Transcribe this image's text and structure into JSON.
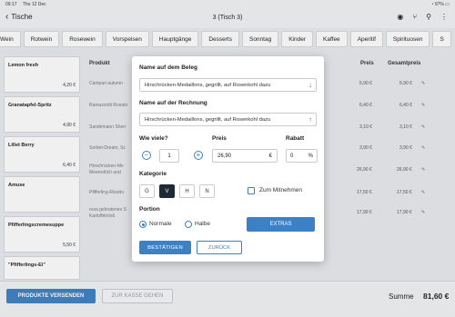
{
  "status": {
    "time": "09:17",
    "date": "Thu 12 Dec",
    "battery": "97%"
  },
  "nav": {
    "back_label": "Tische",
    "title": "3 (Tisch 3)"
  },
  "categories": [
    "Wein",
    "Rotwein",
    "Rosewein",
    "Vorspeisen",
    "Hauptgänge",
    "Desserts",
    "Sonntag",
    "Kinder",
    "Kaffee",
    "Aperitif",
    "Spirituosen",
    "S"
  ],
  "products": [
    {
      "name": "Lemon fresh",
      "price": "4,20 €"
    },
    {
      "name": "Granatapfel-Spritz",
      "price": "4,90 €"
    },
    {
      "name": "Lillet Berry",
      "price": "6,40 €"
    },
    {
      "name": "Amuse",
      "price": ""
    },
    {
      "name": "Pfifferlingscremesuppe",
      "price": "5,50 €"
    },
    {
      "name": "\"Pfifferlings-Ei\"",
      "price": ""
    }
  ],
  "order_table": {
    "headers": {
      "produkt": "Produkt",
      "preis": "Preis",
      "gesamtpreis": "Gesamtpreis"
    },
    "rows": [
      {
        "l1": "Campari autumn",
        "l2": "",
        "preis": "5,90 €",
        "gesamt": "5,90 €"
      },
      {
        "l1": "Ramazzotti Rosato",
        "l2": "",
        "preis": "6,40 €",
        "gesamt": "6,40 €"
      },
      {
        "l1": "Sandemann Sherr",
        "l2": "",
        "preis": "3,10 €",
        "gesamt": "3,10 €"
      },
      {
        "l1": "Sorbet-Dream, Sc",
        "l2": "",
        "preis": "3,90 €",
        "gesamt": "3,90 €"
      },
      {
        "l1": "Hirschrücken-Me",
        "l2": "Meerrettich und",
        "preis": "26,90 €",
        "gesamt": "26,90 €"
      },
      {
        "l1": "Pfifferling-Risotto",
        "l2": "",
        "preis": "17,50 €",
        "gesamt": "17,50 €"
      },
      {
        "l1": "rosa gebratenes S",
        "l2": "Kartoffelrösti",
        "preis": "17,90 €",
        "gesamt": "17,90 €"
      }
    ]
  },
  "footer": {
    "send_label": "PRODUKTE VERSENDEN",
    "kasse_label": "ZUR KASSE GEHEN",
    "summe_label": "Summe",
    "summe_value": "81,60 €"
  },
  "modal": {
    "beleg_label": "Name auf dem Beleg",
    "beleg_value": "Hirschrücken-Medaillons, gegrillt, auf Rosenkohl dazu",
    "rechnung_label": "Name auf der Rechnung",
    "rechnung_value": "Hirschrücken-Medaillons, gegrillt, auf Rosenkohl dazu",
    "qty_label": "Wie viele?",
    "qty_value": "1",
    "preis_label": "Preis",
    "preis_value": "26,90",
    "preis_unit": "€",
    "rabatt_label": "Rabatt",
    "rabatt_value": "0",
    "rabatt_unit": "%",
    "kategorie_label": "Kategorie",
    "kategorien": [
      "G",
      "V",
      "H",
      "N"
    ],
    "kategorie_selected": "V",
    "mitnehmen_label": "Zum Mitnehmen",
    "portion_label": "Portion",
    "portion_normal": "Normale",
    "portion_half": "Halbe",
    "extras_label": "EXTRAS",
    "confirm_label": "BESTÄTIGEN",
    "back_label": "ZURÜCK"
  },
  "colors": {
    "accent": "#3d80c4",
    "selected_category": "#1e2a38"
  }
}
